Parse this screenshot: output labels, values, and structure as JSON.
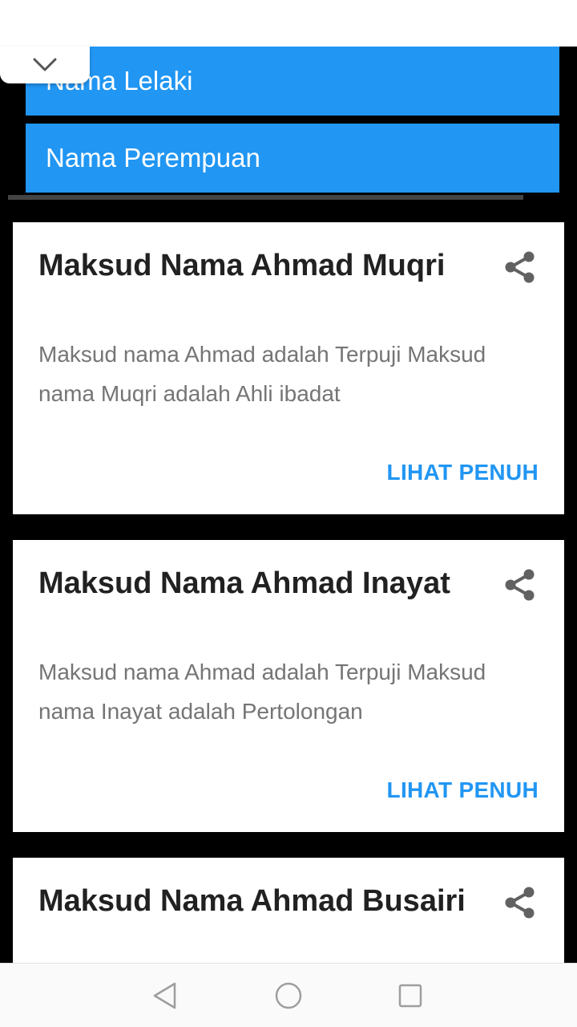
{
  "categories": {
    "male_label": "Nama Lelaki",
    "female_label": "Nama Perempuan"
  },
  "cards": [
    {
      "title": "Maksud Nama Ahmad Muqri",
      "description": "Maksud nama Ahmad adalah Terpuji Maksud nama Muqri adalah Ahli ibadat",
      "action": "LIHAT PENUH"
    },
    {
      "title": "Maksud Nama Ahmad Inayat",
      "description": "Maksud nama Ahmad adalah Terpuji Maksud nama Inayat adalah Pertolongan",
      "action": "LIHAT PENUH"
    },
    {
      "title": "Maksud Nama Ahmad Busairi"
    }
  ],
  "colors": {
    "accent": "#2196f3",
    "background": "#000000",
    "card": "#ffffff",
    "title_text": "#212121",
    "body_text": "#757575"
  },
  "icons": {
    "collapse": "chevron-down-icon",
    "share": "share-icon",
    "nav_back": "back-triangle-icon",
    "nav_home": "home-circle-icon",
    "nav_recents": "recents-square-icon"
  }
}
